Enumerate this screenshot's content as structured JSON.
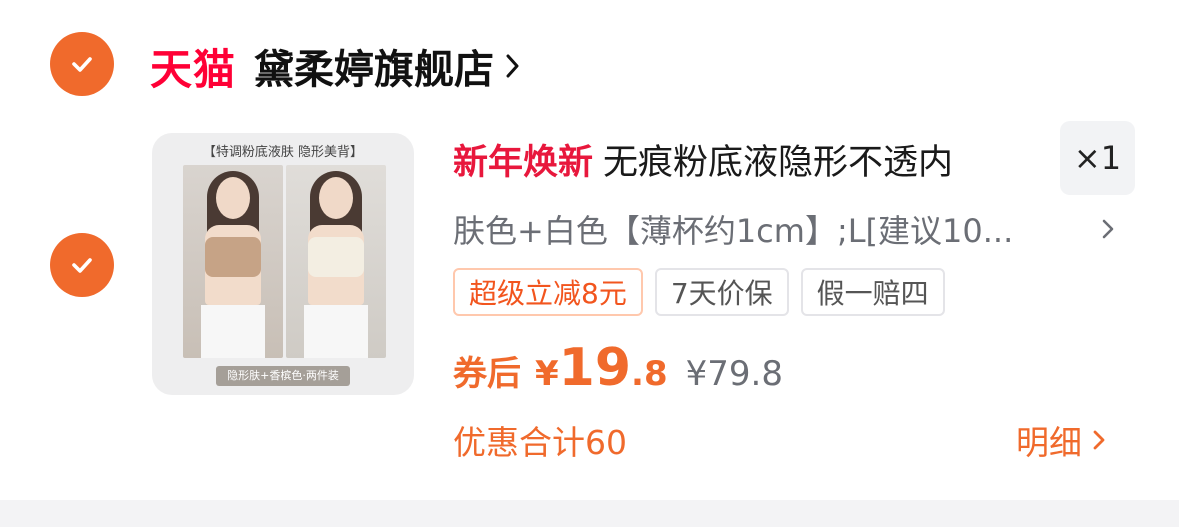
{
  "store": {
    "platform_logo": "天猫",
    "name": "黛柔婷旗舰店"
  },
  "product": {
    "promo_tag": "新年焕新",
    "title": "无痕粉底液隐形不透内",
    "quantity": "×1",
    "sku": "肤色+白色【薄杯约1cm】;L[建议10...",
    "thumbnail": {
      "top_caption": "【特调粉底液肤 隐形美背】",
      "bottom_badge": "隐形肤+香槟色·两件装"
    },
    "tags": [
      "超级立减8元",
      "7天价保",
      "假一赔四"
    ],
    "price": {
      "label": "券后",
      "currency": "¥",
      "integer": "19",
      "decimal": ".8",
      "original": "¥79.8"
    },
    "discount_total": "优惠合计60",
    "detail_label": "明细"
  },
  "colors": {
    "accent": "#f06a2c",
    "tmall_red": "#ff0036",
    "promo_red": "#e8173c"
  },
  "icons": [
    "check-icon",
    "chevron-right-icon"
  ]
}
